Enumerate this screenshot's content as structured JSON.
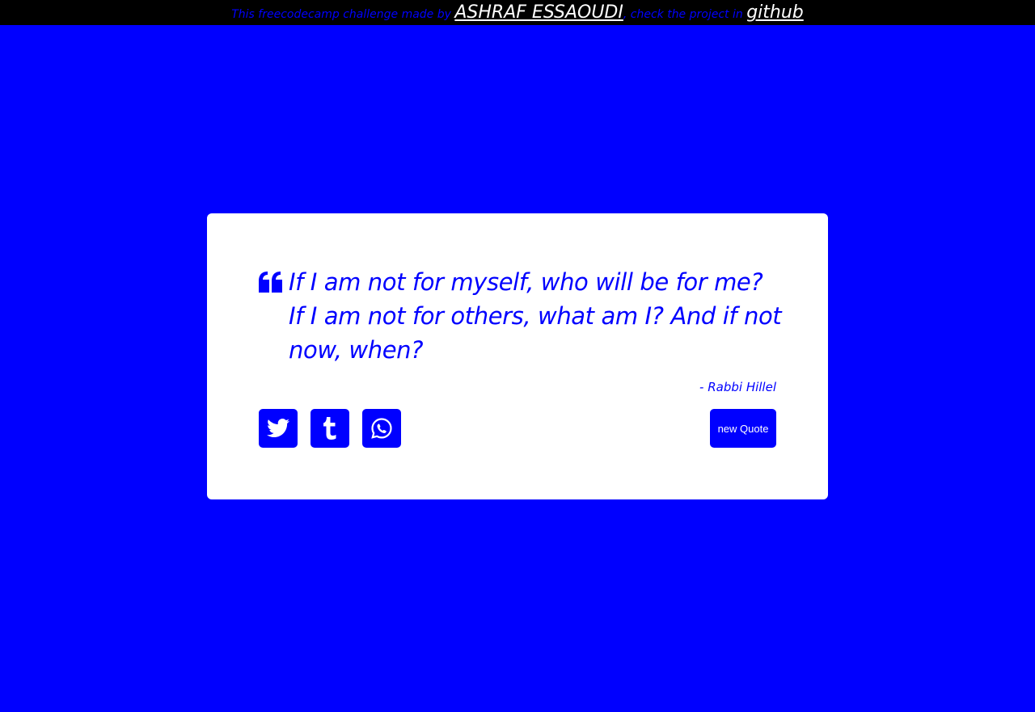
{
  "header": {
    "text_before": "This freecodecamp challenge made by ",
    "author_link": "ASHRAF ESSAOUDI",
    "text_middle": ", check the project in ",
    "github_link": "github"
  },
  "quote": {
    "text": "If I am not for myself, who will be for me? If I am not for others, what am I? And if not now, when?",
    "author": "- Rabbi Hillel"
  },
  "actions": {
    "new_quote_label": "new Quote",
    "share_icons": [
      "twitter-icon",
      "tumblr-icon",
      "whatsapp-icon"
    ]
  },
  "colors": {
    "accent": "#0000ff",
    "card": "#ffffff",
    "topbar": "#000000"
  }
}
